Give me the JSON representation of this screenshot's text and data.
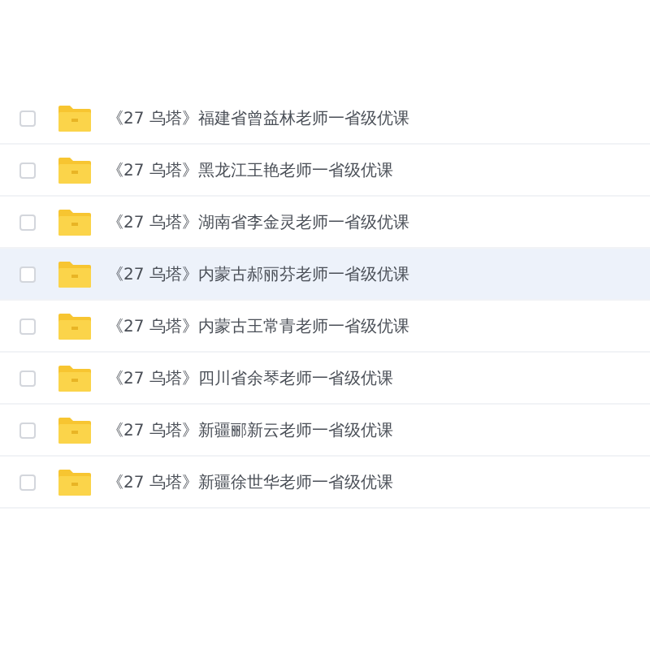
{
  "files": [
    {
      "name": "《27 乌塔》福建省曾益林老师一省级优课",
      "checked": false,
      "highlighted": false
    },
    {
      "name": "《27 乌塔》黑龙江王艳老师一省级优课",
      "checked": false,
      "highlighted": false
    },
    {
      "name": "《27 乌塔》湖南省李金灵老师一省级优课",
      "checked": false,
      "highlighted": false
    },
    {
      "name": "《27 乌塔》内蒙古郝丽芬老师一省级优课",
      "checked": false,
      "highlighted": true
    },
    {
      "name": "《27 乌塔》内蒙古王常青老师一省级优课",
      "checked": false,
      "highlighted": false
    },
    {
      "name": "《27 乌塔》四川省余琴老师一省级优课",
      "checked": false,
      "highlighted": false
    },
    {
      "name": "《27 乌塔》新疆郦新云老师一省级优课",
      "checked": false,
      "highlighted": false
    },
    {
      "name": "《27 乌塔》新疆徐世华老师一省级优课",
      "checked": false,
      "highlighted": false
    }
  ]
}
